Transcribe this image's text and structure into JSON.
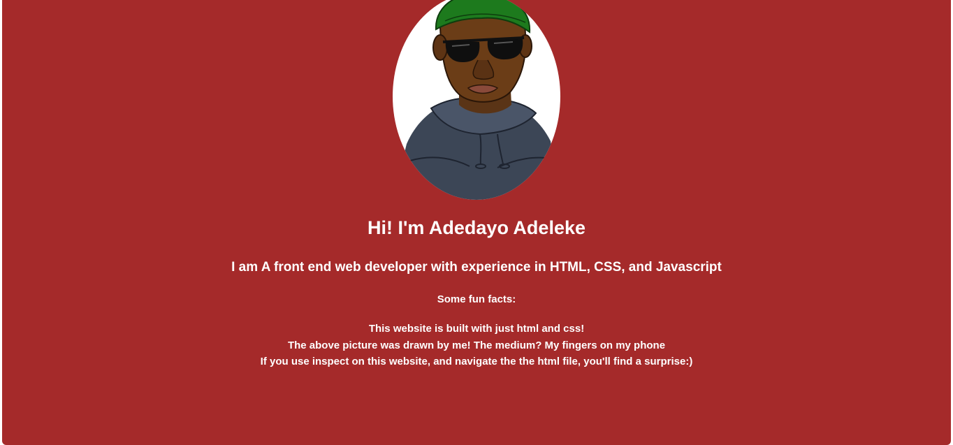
{
  "colors": {
    "background": "#a52a2a",
    "text": "#ffffff"
  },
  "profile": {
    "avatar_icon": "drawn-portrait",
    "name": "Hi! I'm Adedayo Adeleke",
    "tagline": "I am A front end web developer with experience in HTML, CSS, and Javascript"
  },
  "facts": {
    "heading": "Some fun facts:",
    "items": [
      "This website is built with just html and css!",
      "The above picture was drawn by me! The medium? My fingers on my phone",
      "If you use inspect on this website, and navigate the the html file, you'll find a surprise:)"
    ]
  }
}
